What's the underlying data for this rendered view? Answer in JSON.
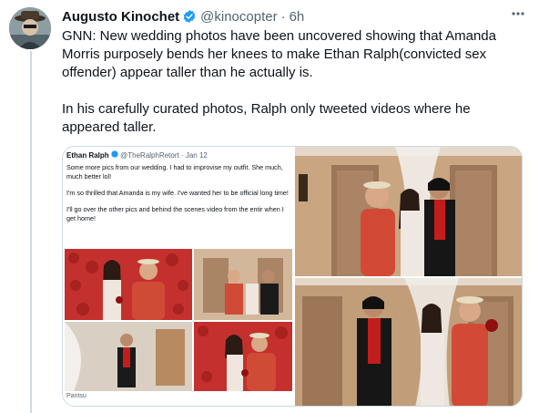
{
  "tweet": {
    "author": {
      "display_name": "Augusto Kinochet",
      "verified": true,
      "handle": "@kinocopter",
      "separator": "·",
      "time": "6h"
    },
    "more_icon": "ellipsis-icon",
    "text": {
      "line1": "GNN: New wedding photos have been uncovered showing that Amanda Morris purposely bends her knees to make Ethan Ralph(convicted sex offender) appear taller than he actually is.",
      "line2": "In his carefully curated photos, Ralph only tweeted videos where he appeared taller."
    },
    "embedded": {
      "name": "Ethan Ralph",
      "handle": "@TheRalphRetort",
      "date": "· Jan 12",
      "p1": "Some more pics from our wedding. I had to improvise my outfit. She much, much better lol!",
      "p2": "I'm so thrilled that Amanda is my wife. I've wanted her to be official long time!",
      "p3": "I'll go over the other pics and behind the scenes video from the entir when I get home!",
      "footer": "Pantsu"
    }
  },
  "colors": {
    "link_blue": "#1d9bf0",
    "secondary_text": "#536471",
    "border": "#cfd9de"
  }
}
